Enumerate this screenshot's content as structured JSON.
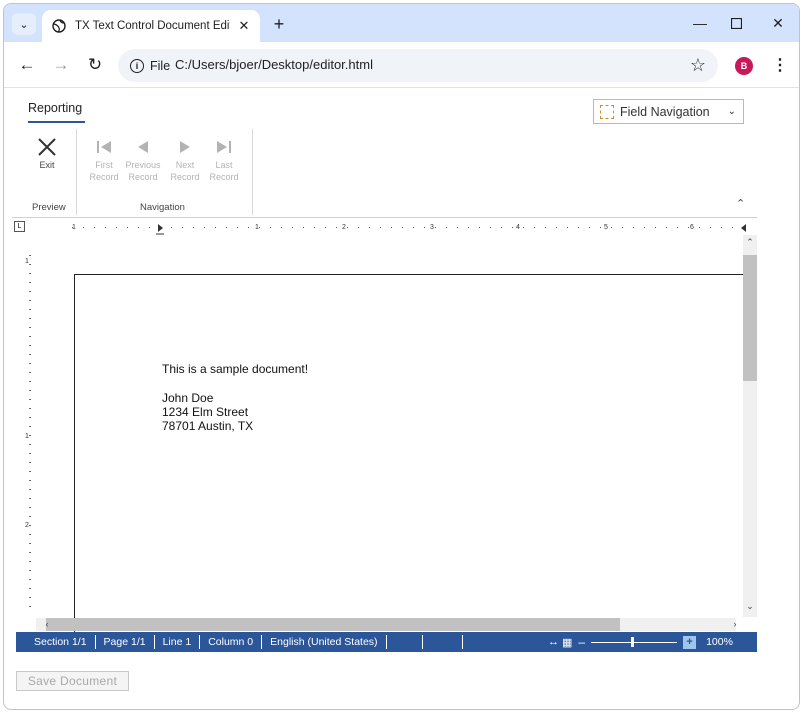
{
  "browser": {
    "tab_title": "TX Text Control Document Edito",
    "address_chip": "File",
    "url": "C:/Users/bjoer/Desktop/editor.html",
    "profile_initial": "B"
  },
  "ribbon": {
    "active_tab": "Reporting",
    "field_navigation_label": "Field Navigation",
    "groups": {
      "preview_label": "Preview",
      "navigation_label": "Navigation"
    },
    "buttons": {
      "exit": "Exit",
      "first_record": "First\nRecord",
      "previous_record": "Previous\nRecord",
      "next_record": "Next\nRecord",
      "last_record": "Last\nRecord"
    }
  },
  "document": {
    "line1": "This is a sample document!",
    "line2": "John Doe",
    "line3": "1234 Elm Street",
    "line4": "78701 Austin, TX"
  },
  "ruler": {
    "numbers": [
      "1",
      "1",
      "2",
      "3",
      "4",
      "5",
      "6"
    ],
    "vertical_numbers": [
      "1",
      "1",
      "2"
    ]
  },
  "statusbar": {
    "section": "Section 1/1",
    "page": "Page 1/1",
    "line": "Line 1",
    "column": "Column 0",
    "language": "English (United States)",
    "zoom": "100%"
  },
  "footer": {
    "save_button": "Save Document"
  },
  "colors": {
    "accent": "#2b579a",
    "tabbar": "#d3e3fd",
    "avatar": "#c5195a"
  }
}
